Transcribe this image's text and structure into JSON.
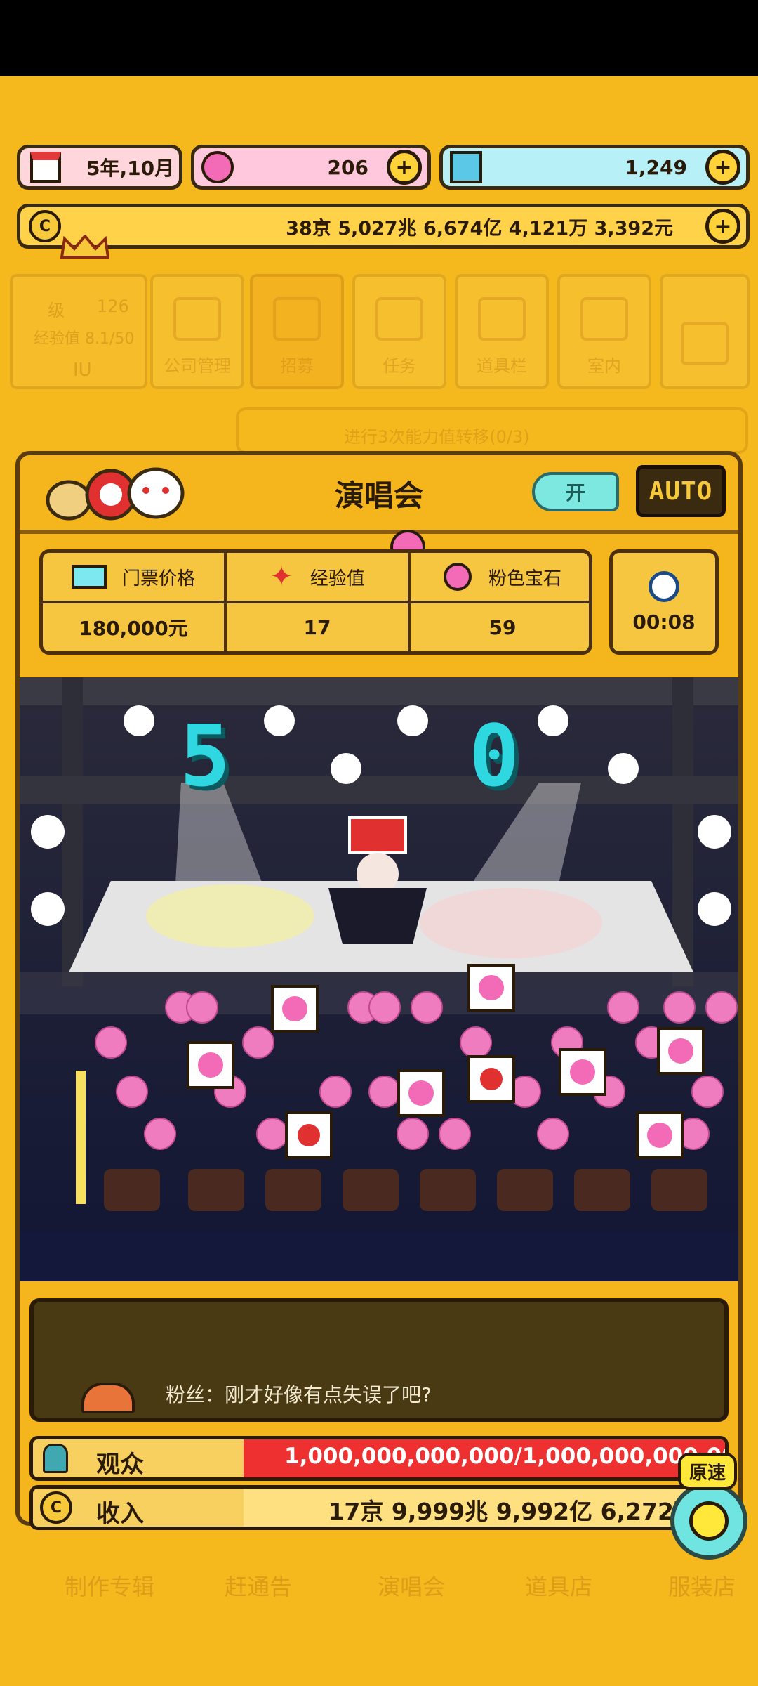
{
  "status": {
    "date": "5年,10月",
    "pink_gems": "206",
    "diamonds": "1,249",
    "money": "38京 5,027兆 6,674亿 4,121万 3,392元",
    "plus": "+"
  },
  "bg_menu": {
    "level_label": "级",
    "level_value": "126",
    "exp_label": "经验值 8.1/50",
    "name": "IU",
    "items": [
      "公司管理",
      "招募",
      "任务",
      "道具栏",
      "室内"
    ],
    "quest_text": "进行3次能力值转移(0/3)"
  },
  "bottom_tabs": [
    "制作专辑",
    "赶通告",
    "演唱会",
    "道具店",
    "服装店"
  ],
  "concert": {
    "title": "演唱会",
    "toggle_label": "开",
    "auto_label": "AUTO",
    "stats": [
      {
        "label": "门票价格",
        "value": "180,000元"
      },
      {
        "label": "经验值",
        "value": "17"
      },
      {
        "label": "粉色宝石",
        "value": "59"
      }
    ],
    "timer": "00:08",
    "combo_left": "5",
    "combo_right": "0",
    "fan_message": "粉丝：刚才好像有点失误了吧?",
    "audience_label": "观众",
    "audience_value": "1,000,000,000,000/1,000,000,000,000",
    "audience_progress": 1.0,
    "income_label": "收入",
    "income_value": "17京 9,999兆 9,992亿 6,272万",
    "speed_label": "原速"
  },
  "colors": {
    "background": "#F5B91E",
    "pink_pill": "#FFC8DC",
    "cyan_pill": "#B8F0F8",
    "audience_bar": "#EE3030",
    "accent_cyan": "#2FD8E0"
  }
}
